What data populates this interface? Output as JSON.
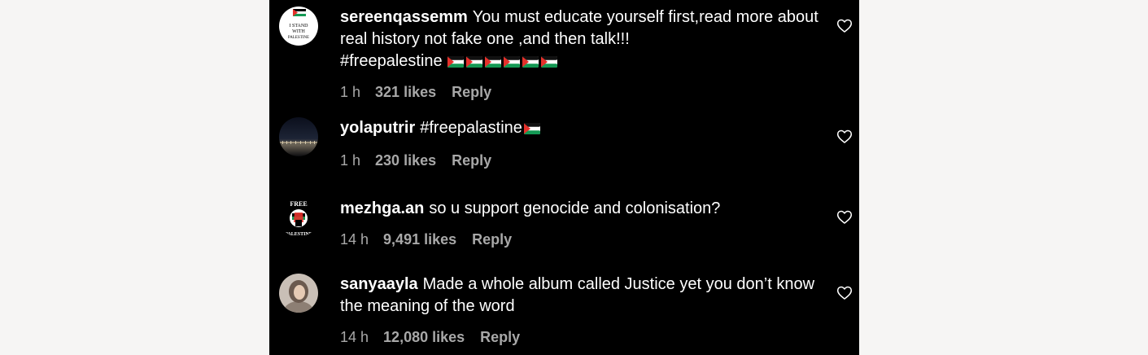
{
  "comments": [
    {
      "username": "sereenqassemm",
      "text": "You must educate yourself first,read more about real history not fake one ,and then talk!!!",
      "text_line2": "#freepalestine",
      "flag_count": 6,
      "time": "1 h",
      "likes": "321 likes",
      "reply": "Reply",
      "avatar_text": [
        "I STAND",
        "WITH",
        "PALESTINE"
      ]
    },
    {
      "username": "yolaputrir",
      "text": "#freepalastine",
      "flag_count": 1,
      "time": "1 h",
      "likes": "230 likes",
      "reply": "Reply"
    },
    {
      "username": "mezhga.an",
      "text": "so u support genocide and colonisation?",
      "time": "14 h",
      "likes": "9,491 likes",
      "reply": "Reply",
      "avatar_text": [
        "FREE",
        "PALESTINE"
      ]
    },
    {
      "username": "sanyaayla",
      "text": "Made a whole album called Justice yet you don’t know the meaning of the word",
      "time": "14 h",
      "likes": "12,080 likes",
      "reply": "Reply"
    }
  ],
  "colors": {
    "panel_bg": "#000000",
    "meta_text": "#a8a8a8",
    "flag_red": "#e4312b",
    "flag_green": "#149954"
  }
}
